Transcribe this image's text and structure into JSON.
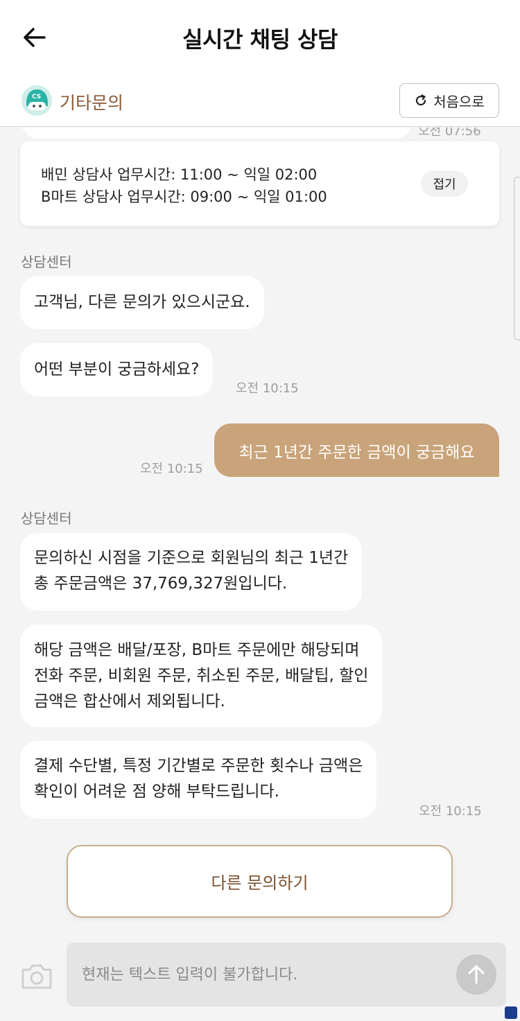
{
  "header": {
    "title": "실시간 채팅 상담"
  },
  "subheader": {
    "category": "기타문의",
    "avatar_text": "CS",
    "restart_label": "처음으로"
  },
  "chat": {
    "peek_time": "오전 07:56",
    "notice": {
      "line1": "배민 상담사 업무시간: 11:00 ~ 익일 02:00",
      "line2": "B마트 상담사 업무시간: 09:00 ~ 익일 01:00",
      "fold_label": "접기"
    },
    "group1": {
      "sender": "상담센터",
      "messages": [
        "고객님, 다른 문의가 있으시군요.",
        "어떤 부분이 궁금하세요?"
      ],
      "time": "오전 10:15"
    },
    "user_message": {
      "text": "최근 1년간 주문한 금액이 궁금해요",
      "time": "오전 10:15"
    },
    "group2": {
      "sender": "상담센터",
      "msg1": [
        "문의하신 시점을 기준으로 회원님의 최근 1년간",
        "총 주문금액은 37,769,327원입니다."
      ],
      "msg2": [
        "해당 금액은 배달/포장, B마트 주문에만 해당되며",
        "전화 주문, 비회원 주문, 취소된 주문, 배달팁, 할인",
        "금액은 합산에서 제외됩니다."
      ],
      "msg3": [
        "결제 수단별, 특정 기간별로 주문한 횟수나 금액은",
        "확인이 어려운 점 양해 부탁드립니다."
      ],
      "time": "오전 10:15"
    }
  },
  "actions": {
    "other_inquiry_label": "다른 문의하기"
  },
  "composer": {
    "placeholder": "현재는 텍스트 입력이 불가합니다."
  },
  "colors": {
    "accent_brown": "#c9a47a",
    "text_brown": "#8a5a35",
    "background": "#f4f4f4"
  }
}
